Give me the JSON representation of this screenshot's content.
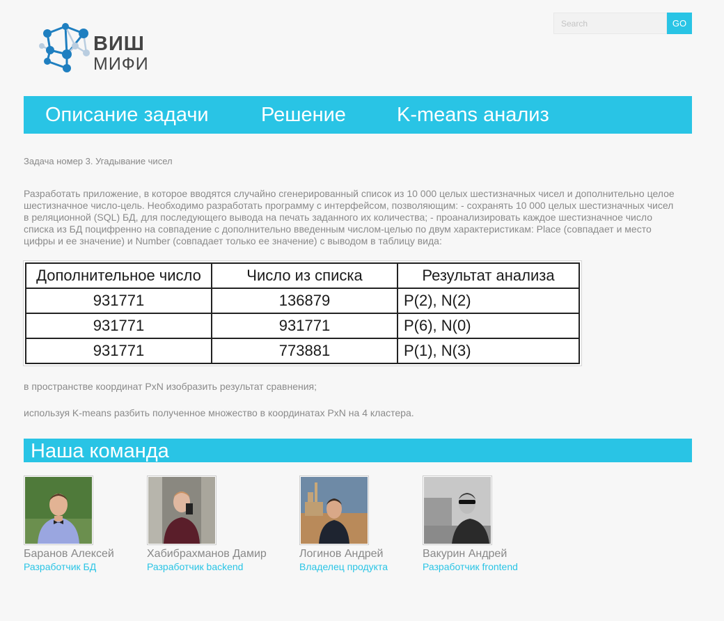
{
  "logo": {
    "line1": "ВИШ",
    "line2": "МИФИ"
  },
  "search": {
    "placeholder": "Search",
    "button_label": "GO"
  },
  "nav": {
    "items": [
      {
        "label": "Описание задачи"
      },
      {
        "label": "Решение"
      },
      {
        "label": "K-means анализ"
      }
    ]
  },
  "task": {
    "title": "Задача номер 3. Угадывание чисел",
    "description": "Разработать приложение, в которое вводятся случайно сгенерированный список из 10 000 целых шестизначных чисел и дополнительно целое шестизначное число-цель. Необходимо разработать программу с интерфейсом, позволяющим: - сохранять 10 000 целых шестизначных чисел в реляционной (SQL) БД, для последующего вывода на печать заданного их количества; - проанализировать каждое шестизначное число списка из БД поцифренно на совпадение с дополнительно введенным числом-целью по двум характеристикам: Place (совпадает и место цифры и ее значение) и Number (совпадает только ее значение) с выводом в таблицу вида:",
    "table": {
      "headers": [
        "Дополнительное число",
        "Число из списка",
        "Результат анализа"
      ],
      "rows": [
        [
          "931771",
          "136879",
          "P(2), N(2)"
        ],
        [
          "931771",
          "931771",
          "P(6), N(0)"
        ],
        [
          "931771",
          "773881",
          "P(1), N(3)"
        ]
      ]
    },
    "para2": "в пространстве координат PxN изобразить результат сравнения;",
    "para3": "используя K-means разбить полученное множество в координатах PxN на 4 кластера."
  },
  "team": {
    "title": "Наша команда",
    "members": [
      {
        "name": "Баранов Алексей",
        "role": "Разработчик БД"
      },
      {
        "name": "Хабибрахманов Дамир",
        "role": "Разработчик backend"
      },
      {
        "name": "Логинов Андрей",
        "role": "Владелец продукта"
      },
      {
        "name": "Вакурин Андрей",
        "role": "Разработчик frontend"
      }
    ]
  },
  "colors": {
    "accent": "#29c4e5",
    "text": "#8a8a8a",
    "background": "#f7f7f7"
  },
  "icons": {
    "logo": "molecule-network-icon"
  }
}
